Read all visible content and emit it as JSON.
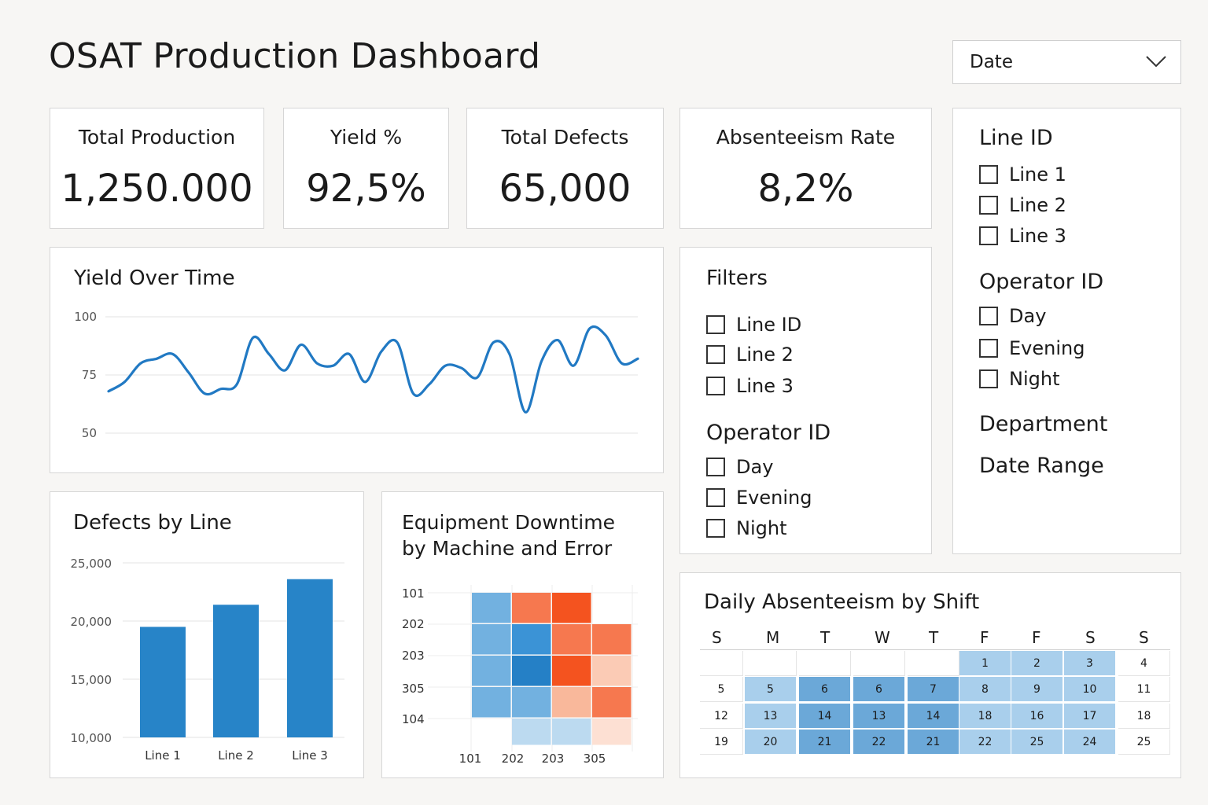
{
  "header": {
    "title": "OSAT Production Dashboard",
    "date_select": "Date"
  },
  "kpis": [
    {
      "label": "Total Production",
      "value": "1,250.000"
    },
    {
      "label": "Yield %",
      "value": "92,5%"
    },
    {
      "label": "Total Defects",
      "value": "65,000"
    },
    {
      "label": "Absenteeism Rate",
      "value": "8,2%"
    }
  ],
  "right_panel": {
    "line_title": "Line ID",
    "lines": [
      "Line 1",
      "Line 2",
      "Line 3"
    ],
    "operator_title": "Operator ID",
    "operators": [
      "Day",
      "Evening",
      "Night"
    ],
    "department": "Department",
    "date_range": "Date Range"
  },
  "filters": {
    "title": "Filters",
    "lines": [
      "Line ID",
      "Line 2",
      "Line 3"
    ],
    "operator_title": "Operator ID",
    "operators": [
      "Day",
      "Evening",
      "Night"
    ]
  },
  "yield_chart": {
    "title": "Yield Over Time",
    "y_ticks": [
      "100",
      "75",
      "50"
    ]
  },
  "defects_chart": {
    "title": "Defects by Line",
    "y_ticks": [
      "25,000",
      "20,000",
      "15,000",
      "10,000"
    ]
  },
  "downtime_chart": {
    "title_line1": "Equipment Downtime",
    "title_line2": "by Machine and Error",
    "rows": [
      "101",
      "202",
      "203",
      "305",
      "104"
    ],
    "cols": [
      "101",
      "202",
      "203",
      "305"
    ]
  },
  "absenteeism": {
    "title": "Daily Absenteeism by Shift",
    "day_headers": [
      "S",
      "M",
      "T",
      "W",
      "T",
      "F",
      "F",
      "S",
      "S"
    ],
    "weeks": [
      [
        "",
        "",
        "",
        "",
        "",
        "1",
        "2",
        "3",
        "4"
      ],
      [
        "5",
        "5",
        "6",
        "6",
        "7",
        "8",
        "9",
        "10",
        "11"
      ],
      [
        "12",
        "13",
        "14",
        "13",
        "14",
        "18",
        "16",
        "17",
        "18"
      ],
      [
        "19",
        "20",
        "21",
        "22",
        "21",
        "22",
        "25",
        "24",
        "25"
      ]
    ],
    "shades": [
      [
        0,
        0,
        0,
        0,
        0,
        1,
        1,
        1,
        0
      ],
      [
        0,
        1,
        2,
        2,
        2,
        1,
        1,
        1,
        0
      ],
      [
        0,
        1,
        2,
        2,
        2,
        1,
        1,
        1,
        0
      ],
      [
        0,
        1,
        2,
        2,
        2,
        1,
        1,
        1,
        0
      ]
    ],
    "colors": {
      "light": "#a9cfec",
      "mid": "#6ba8d8"
    }
  },
  "chart_data": [
    {
      "type": "line",
      "title": "Yield Over Time",
      "xlabel": "",
      "ylabel": "",
      "ylim": [
        50,
        100
      ],
      "y_ticks": [
        50,
        75,
        100
      ],
      "series": [
        {
          "values": [
            68,
            72,
            80,
            82,
            84,
            76,
            67,
            69,
            71,
            91,
            84,
            77,
            88,
            80,
            79,
            84,
            72,
            85,
            89,
            67,
            71,
            79,
            78,
            74,
            89,
            84,
            59,
            81,
            90,
            79,
            95,
            92,
            80,
            82
          ]
        }
      ],
      "color": "#2179c3",
      "grid": true
    },
    {
      "type": "bar",
      "title": "Defects by Line",
      "categories": [
        "Line 1",
        "Line 2",
        "Line 3"
      ],
      "values": [
        19500,
        21400,
        23600
      ],
      "ylim": [
        10000,
        25000
      ],
      "y_ticks": [
        10000,
        15000,
        20000,
        25000
      ],
      "color": "#2784c8",
      "grid": true
    },
    {
      "type": "heatmap",
      "title": "Equipment Downtime by Machine and Error",
      "rows": [
        "101",
        "202",
        "203",
        "305",
        "104"
      ],
      "cols": [
        "101",
        "202",
        "203",
        "305"
      ],
      "cell_colors": [
        [
          "#72b1e0",
          "#f6784f",
          "#f4531f",
          null
        ],
        [
          "#72b1e0",
          "#3b93d6",
          "#f6784f",
          "#f6784f"
        ],
        [
          "#72b1e0",
          "#2580c6",
          "#f4531f",
          "#fbcbb5"
        ],
        [
          "#72b1e0",
          "#72b1e0",
          "#f9b89b",
          "#f6784f"
        ],
        [
          null,
          "#bcdaf0",
          "#bcdaf0",
          "#fde0d3"
        ]
      ]
    }
  ]
}
